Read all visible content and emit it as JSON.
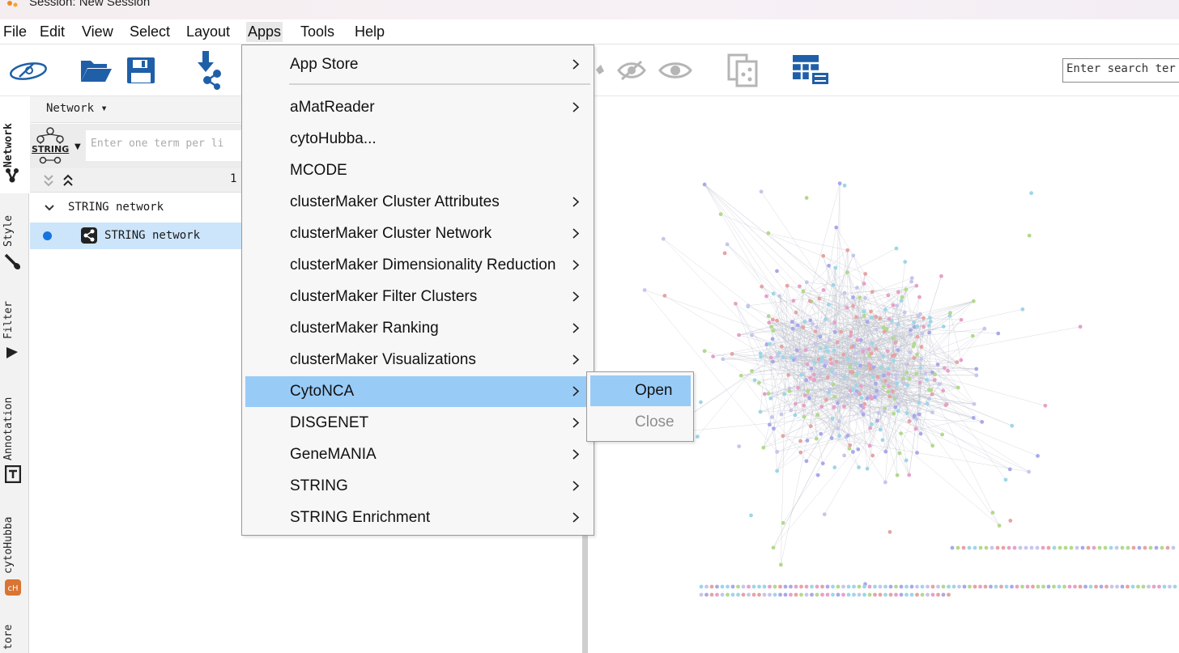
{
  "window": {
    "title": "Session: New Session"
  },
  "menubar": [
    "File",
    "Edit",
    "View",
    "Select",
    "Layout",
    "Apps",
    "Tools",
    "Help"
  ],
  "toolbar": {
    "search_placeholder": "Enter search ter"
  },
  "side_tabs": [
    "Network",
    "Style",
    "Filter",
    "Annotation",
    "cytoHubba",
    "tore"
  ],
  "control_panel": {
    "header_label": "Network ▾",
    "string_label": "STRING",
    "query_placeholder": "Enter one term per li",
    "count": "1",
    "tree": {
      "parent": "STRING network",
      "child": "STRING network"
    }
  },
  "apps_menu": {
    "items": [
      {
        "label": "App Store",
        "submenu": true
      },
      {
        "label": "aMatReader",
        "submenu": true
      },
      {
        "label": "cytoHubba...",
        "submenu": false
      },
      {
        "label": "MCODE",
        "submenu": false
      },
      {
        "label": "clusterMaker Cluster Attributes",
        "submenu": true
      },
      {
        "label": "clusterMaker Cluster Network",
        "submenu": true
      },
      {
        "label": "clusterMaker Dimensionality Reduction",
        "submenu": true
      },
      {
        "label": "clusterMaker Filter Clusters",
        "submenu": true
      },
      {
        "label": "clusterMaker Ranking",
        "submenu": true
      },
      {
        "label": "clusterMaker Visualizations",
        "submenu": true
      },
      {
        "label": "CytoNCA",
        "submenu": true,
        "highlighted": true
      },
      {
        "label": "DISGENET",
        "submenu": true
      },
      {
        "label": "GeneMANIA",
        "submenu": true
      },
      {
        "label": "STRING",
        "submenu": true
      },
      {
        "label": "STRING Enrichment",
        "submenu": true
      }
    ]
  },
  "cytonca_submenu": {
    "open": "Open",
    "close": "Close"
  },
  "colors": {
    "menu_highlight": "#99cbf7",
    "selection": "#cce5fb",
    "icon_blue": "#1f5fa8",
    "node_palette": [
      "#b3d98c",
      "#e8a0c8",
      "#a8a8ec",
      "#9dd6e8",
      "#e6a3a3",
      "#c6c6ec"
    ]
  }
}
